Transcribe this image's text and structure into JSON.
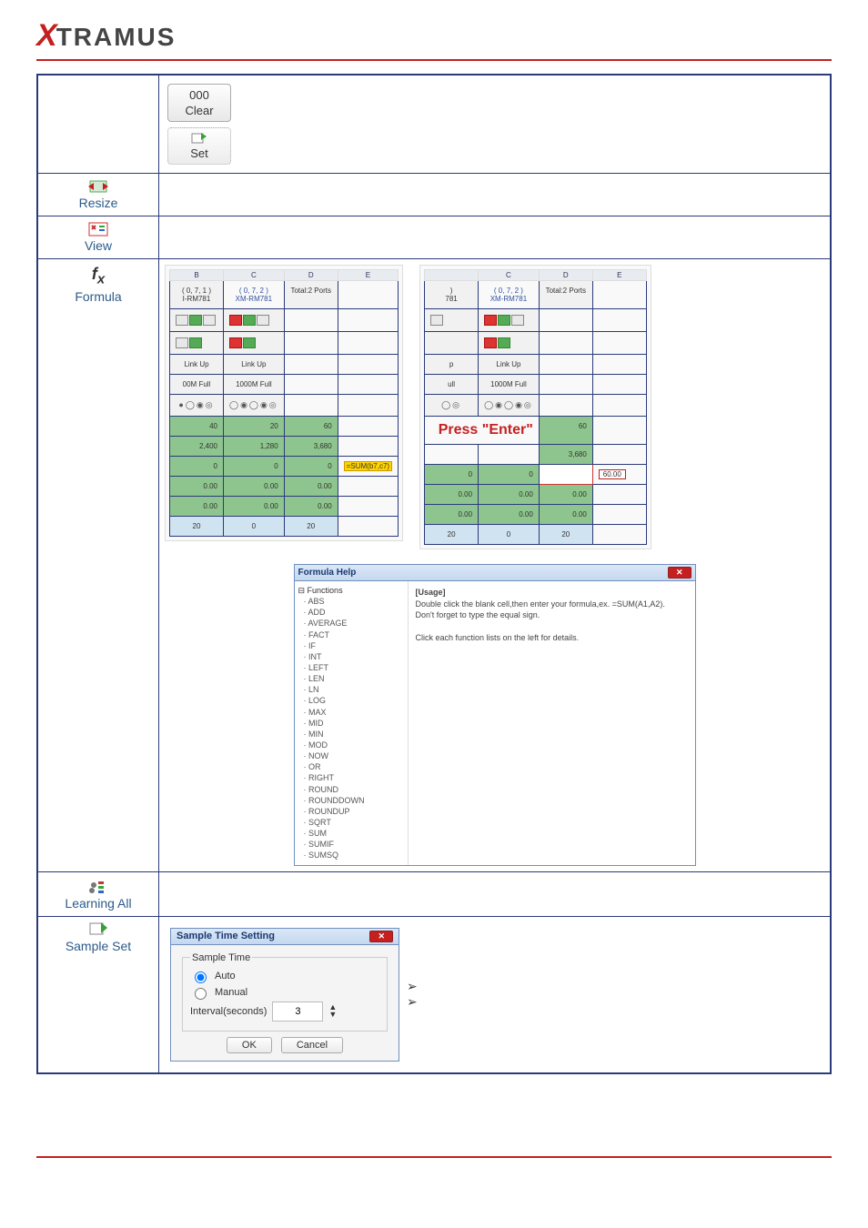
{
  "brand": {
    "x": "X",
    "rest": "TRAMUS"
  },
  "rows": {
    "blank_clear": "Clear",
    "blank_set": "Set",
    "blank_zero": "000",
    "resize": "Resize",
    "view": "View",
    "formula": "Formula",
    "learning_all": "Learning All",
    "sample_set": "Sample Set"
  },
  "sheetL": {
    "cols": [
      "B",
      "C",
      "D",
      "E"
    ],
    "port1": {
      "coord": "( 0, 7, 1 )",
      "model": "I-RM781"
    },
    "port2": {
      "coord": "( 0, 7, 2 )",
      "model": "XM-RM781"
    },
    "total": "Total:2 Ports",
    "link": "Link Up",
    "speed1": "00M Full",
    "speed2": "1000M Full",
    "green": {
      "r1b": "40",
      "r1c": "20",
      "r1d": "60",
      "r2b": "2,400",
      "r2c": "1,280",
      "r2d": "3,680",
      "r3b": "0",
      "r3c": "0",
      "r3d": "0",
      "r4b": "0.00",
      "r4c": "0.00",
      "r4d": "0.00",
      "r5b": "0.00",
      "r5c": "0.00",
      "r5d": "0.00"
    },
    "blue": {
      "b1": "20",
      "b2": "0",
      "b3": "20"
    },
    "formula_cell": "=SUM(b7,c7)"
  },
  "sheetR": {
    "cols": [
      "",
      "C",
      "D",
      "E"
    ],
    "port": {
      "coord": "( 0, 7, 2 )",
      "model": "XM-RM781"
    },
    "total": "Total:2 Ports",
    "link": "Link Up",
    "speed": "1000M Full",
    "press": "Press \"Enter\"",
    "green": {
      "r1d": "60",
      "r2d": "3,680",
      "r3b": "0",
      "r3c": "0",
      "r4b": "0.00",
      "r4c": "0.00",
      "r4d": "0.00",
      "r5b": "0.00",
      "r5c": "0.00",
      "r5d": "0.00"
    },
    "blue": {
      "b1": "20",
      "b2": "0",
      "b3": "20"
    },
    "chip60": "60.00",
    "speed_short": "ull",
    "link_short": "p",
    "model_short": "781",
    "coord_short": ")"
  },
  "formulaHelp": {
    "title": "Formula Help",
    "root": "Functions",
    "funcs": [
      "ABS",
      "ADD",
      "AVERAGE",
      "FACT",
      "IF",
      "INT",
      "LEFT",
      "LEN",
      "LN",
      "LOG",
      "MAX",
      "MID",
      "MIN",
      "MOD",
      "NOW",
      "OR",
      "RIGHT",
      "ROUND",
      "ROUNDDOWN",
      "ROUNDUP",
      "SQRT",
      "SUM",
      "SUMIF",
      "SUMSQ"
    ],
    "usage_hdr": "[Usage]",
    "usage_l1": "Double click the blank cell,then enter your formula,ex. =SUM(A1,A2).",
    "usage_l2": "Don't forget to type the equal sign.",
    "usage_l3": "Click each function lists on the left for details."
  },
  "sample": {
    "title": "Sample Time Setting",
    "group": "Sample Time",
    "auto": "Auto",
    "manual": "Manual",
    "interval_label": "Interval(seconds)",
    "interval_value": "3",
    "ok": "OK",
    "cancel": "Cancel"
  }
}
